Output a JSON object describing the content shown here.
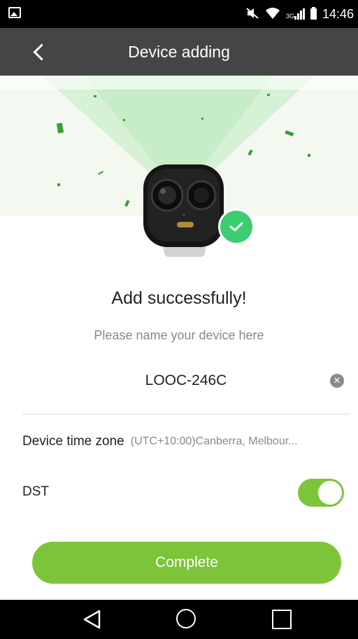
{
  "status_bar": {
    "time": "14:46",
    "network": "3G",
    "icons": [
      "gallery-icon",
      "mute-icon",
      "wifi-icon",
      "signal-icon",
      "battery-icon"
    ]
  },
  "app_bar": {
    "title": "Device adding",
    "back_icon": "chevron-left-icon"
  },
  "main": {
    "headline": "Add successfully!",
    "prompt": "Please name your device here",
    "device_name": "LOOC-246C",
    "time_zone_label": "Device time zone",
    "time_zone_value": "(UTC+10:00)Canberra, Melbour...",
    "dst_label": "DST",
    "dst_enabled": true,
    "complete_label": "Complete"
  },
  "colors": {
    "accent": "#7dc43b",
    "app_bar": "#454545",
    "success": "#3ccd70"
  }
}
